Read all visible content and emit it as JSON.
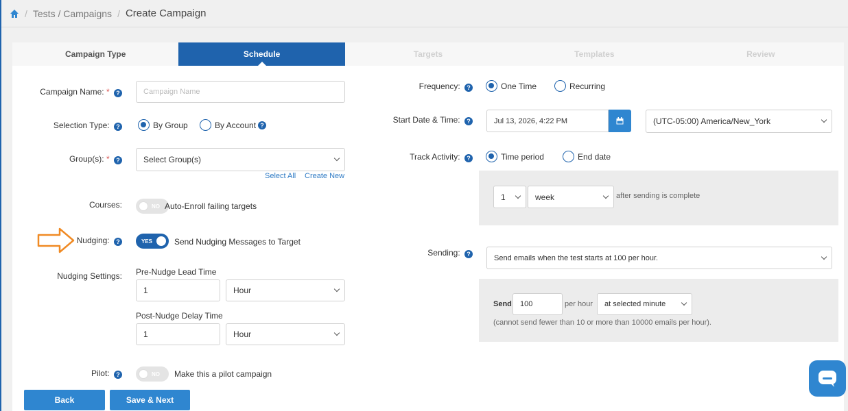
{
  "breadcrumb": {
    "items": [
      "Tests / Campaigns"
    ],
    "current": "Create Campaign",
    "separator": "/"
  },
  "steps": [
    {
      "label": "Campaign Type",
      "state": "done"
    },
    {
      "label": "Schedule",
      "state": "active"
    },
    {
      "label": "Targets",
      "state": "disabled"
    },
    {
      "label": "Templates",
      "state": "disabled"
    },
    {
      "label": "Review",
      "state": "disabled"
    }
  ],
  "form": {
    "campaign_name": {
      "label": "Campaign Name:",
      "required": "*",
      "placeholder": "Campaign Name"
    },
    "selection_type": {
      "label": "Selection Type:",
      "options": [
        "By Group",
        "By Account"
      ],
      "selected": "By Group"
    },
    "groups": {
      "label": "Group(s):",
      "required": "*",
      "value": "Select Group(s)",
      "select_all": "Select All",
      "create_new": "Create New"
    },
    "courses": {
      "label": "Courses:",
      "toggle": "NO",
      "text": "Auto-Enroll failing targets"
    },
    "nudging": {
      "label": "Nudging:",
      "toggle": "YES",
      "text": "Send Nudging Messages to Target"
    },
    "nudging_settings": {
      "label": "Nudging Settings:",
      "pre_title": "Pre-Nudge Lead Time",
      "pre_value": "1",
      "pre_unit": "Hour",
      "post_title": "Post-Nudge Delay Time",
      "post_value": "1",
      "post_unit": "Hour"
    },
    "pilot": {
      "label": "Pilot:",
      "toggle": "NO",
      "text": "Make this a pilot campaign"
    },
    "frequency": {
      "label": "Frequency:",
      "options": [
        "One Time",
        "Recurring"
      ],
      "selected": "One Time"
    },
    "start": {
      "label": "Start Date & Time:",
      "value": "Jul 13, 2026, 4:22 PM",
      "timezone": "(UTC-05:00) America/New_York"
    },
    "track": {
      "label": "Track Activity:",
      "options": [
        "Time period",
        "End date"
      ],
      "selected": "Time period",
      "count": "1",
      "unit": "week",
      "suffix": "after sending is complete"
    },
    "sending": {
      "label": "Sending:",
      "value": "Send emails when the test starts at 100 per hour.",
      "send_label": "Send",
      "rate": "100",
      "per_hour": "per hour",
      "minute": "at selected minute",
      "note": "(cannot send fewer than 10 or more than 10000 emails per hour)."
    }
  },
  "buttons": {
    "back": "Back",
    "save_next": "Save & Next"
  },
  "help_glyph": "?",
  "colors": {
    "primary": "#1f63ad",
    "accent": "#2f86d0",
    "arrow": "#f08a24"
  }
}
